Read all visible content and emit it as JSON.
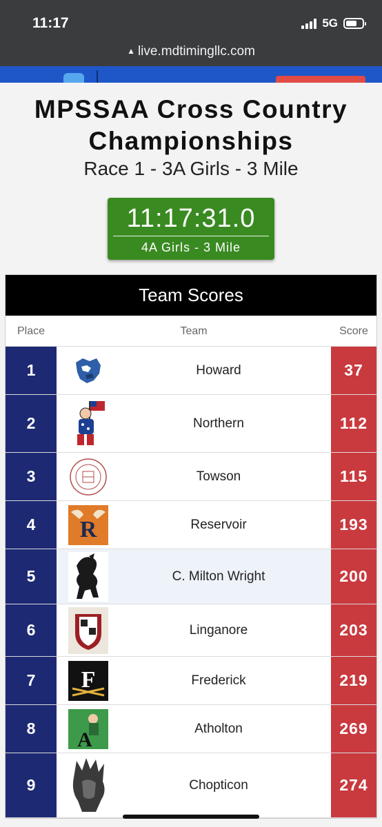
{
  "status_bar": {
    "time": "11:17",
    "network": "5G"
  },
  "browser": {
    "url": "live.mdtimingllc.com"
  },
  "page": {
    "title_line1": "MPSSAA Cross Country",
    "title_line2": "Championships",
    "subtitle": "Race 1 - 3A Girls - 3 Mile"
  },
  "clock": {
    "time": "11:17:31.0",
    "race": "4A Girls - 3 Mile"
  },
  "table": {
    "title": "Team Scores",
    "columns": {
      "place": "Place",
      "team": "Team",
      "score": "Score"
    },
    "rows": [
      {
        "place": "1",
        "team": "Howard",
        "score": "37",
        "logo": "howard-lion-logo"
      },
      {
        "place": "2",
        "team": "Northern",
        "score": "112",
        "logo": "northern-patriot-logo"
      },
      {
        "place": "3",
        "team": "Towson",
        "score": "115",
        "logo": "towson-seal-logo"
      },
      {
        "place": "4",
        "team": "Reservoir",
        "score": "193",
        "logo": "reservoir-r-logo"
      },
      {
        "place": "5",
        "team": "C. Milton Wright",
        "score": "200",
        "logo": "mustang-logo"
      },
      {
        "place": "6",
        "team": "Linganore",
        "score": "203",
        "logo": "linganore-crest-logo"
      },
      {
        "place": "7",
        "team": "Frederick",
        "score": "219",
        "logo": "frederick-f-logo"
      },
      {
        "place": "8",
        "team": "Atholton",
        "score": "269",
        "logo": "atholton-raider-logo"
      },
      {
        "place": "9",
        "team": "Chopticon",
        "score": "274",
        "logo": "chopticon-chief-logo"
      }
    ]
  },
  "colors": {
    "place_bg": "#1d2a73",
    "score_bg": "#c93a3f",
    "clock_bg": "#3a8a22",
    "header_bg": "#000000"
  }
}
